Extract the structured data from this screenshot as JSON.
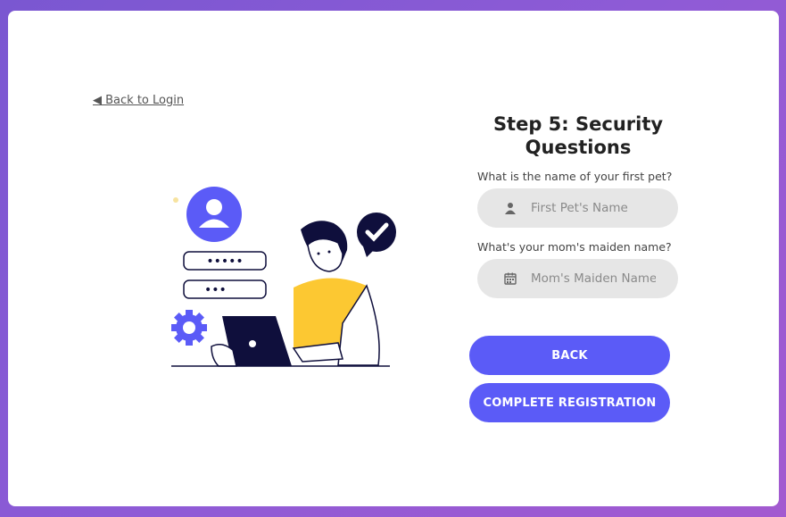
{
  "nav": {
    "back_to_login": "◀ Back to Login"
  },
  "form": {
    "title": "Step 5: Security Questions",
    "questions": [
      {
        "label": "What is the name of your first pet?",
        "placeholder": "First Pet's Name",
        "value": "",
        "icon": "user-icon"
      },
      {
        "label": "What's your mom's maiden name?",
        "placeholder": "Mom's Maiden Name",
        "value": "",
        "icon": "calendar-icon"
      }
    ]
  },
  "buttons": {
    "back": "BACK",
    "complete": "COMPLETE REGISTRATION"
  },
  "illustration": {
    "password_dots": [
      "•••••",
      "•••"
    ],
    "icons": [
      "user-avatar-icon",
      "gear-icon",
      "checkmark-bubble-icon",
      "laptop-icon"
    ]
  },
  "colors": {
    "accent": "#5b5bf7",
    "input_bg": "#e6e6e6",
    "yellow": "#fcc832",
    "navy": "#0f0f3c"
  }
}
